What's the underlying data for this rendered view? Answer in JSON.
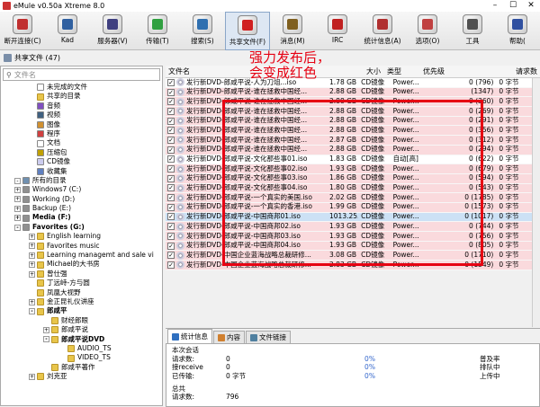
{
  "window": {
    "title": "eMule v0.50a Xtreme 8.0"
  },
  "toolbar": [
    {
      "label": "断开连接(C)",
      "icon": "disconnect-icon",
      "color": "#c03030"
    },
    {
      "label": "Kad",
      "icon": "kad-icon",
      "color": "#3060a0"
    },
    {
      "label": "服务器(V)",
      "icon": "servers-icon",
      "color": "#404080"
    },
    {
      "label": "传输(T)",
      "icon": "transfer-icon",
      "color": "#30a040"
    },
    {
      "label": "搜索(S)",
      "icon": "search-icon",
      "color": "#3070b0"
    },
    {
      "label": "共享文件(F)",
      "icon": "shared-files-icon",
      "color": "#d02020"
    },
    {
      "label": "消息(M)",
      "icon": "messages-icon",
      "color": "#806020"
    },
    {
      "label": "IRC",
      "icon": "irc-icon",
      "color": "#c02020"
    },
    {
      "label": "统计信息(A)",
      "icon": "statistics-icon",
      "color": "#b03030"
    },
    {
      "label": "选项(O)",
      "icon": "options-icon",
      "color": "#c04040"
    },
    {
      "label": "工具",
      "icon": "tools-icon",
      "color": "#505050"
    },
    {
      "label": "帮助(",
      "icon": "help-icon",
      "color": "#3050a0"
    }
  ],
  "shared": {
    "title": "共享文件 (47)"
  },
  "search": {
    "placeholder": "文件名"
  },
  "tree": [
    {
      "label": "未完成的文件",
      "indent": 40,
      "icon": "incomplete-icon",
      "color": "#ffffff"
    },
    {
      "label": "共享的目录",
      "indent": 40,
      "icon": "folder-icon",
      "color": "#e8c54a"
    },
    {
      "label": "音频",
      "indent": 40,
      "icon": "audio-icon",
      "color": "#8050c0"
    },
    {
      "label": "视频",
      "indent": 40,
      "icon": "video-icon",
      "color": "#406080"
    },
    {
      "label": "图像",
      "indent": 40,
      "icon": "image-icon",
      "color": "#d09030"
    },
    {
      "label": "程序",
      "indent": 40,
      "icon": "program-icon",
      "color": "#d04040"
    },
    {
      "label": "文档",
      "indent": 40,
      "icon": "document-icon",
      "color": "#ffffff"
    },
    {
      "label": "压缩包",
      "indent": 40,
      "icon": "archive-icon",
      "color": "#c0a000"
    },
    {
      "label": "CD镜像",
      "indent": 40,
      "icon": "cd-icon",
      "color": "#ccccee"
    },
    {
      "label": "收藏集",
      "indent": 40,
      "icon": "collection-icon",
      "color": "#6080c0"
    },
    {
      "label": "所有的目录",
      "indent": 24,
      "icon": "computer-icon",
      "color": "#7090b0",
      "exp": "-"
    },
    {
      "label": "Windows7 (C:)",
      "indent": 24,
      "icon": "drive-icon",
      "color": "#909090",
      "exp": "+"
    },
    {
      "label": "Working (D:)",
      "indent": 24,
      "icon": "drive-icon",
      "color": "#909090",
      "exp": "+"
    },
    {
      "label": "Backup (E:)",
      "indent": 24,
      "icon": "drive-icon",
      "color": "#909090",
      "exp": "+"
    },
    {
      "label": "Media (F:)",
      "indent": 24,
      "icon": "drive-icon",
      "color": "#909090",
      "exp": "+",
      "bold": true
    },
    {
      "label": "Favorites (G:)",
      "indent": 24,
      "icon": "drive-icon",
      "color": "#909090",
      "exp": "-",
      "bold": true
    },
    {
      "label": "English learning",
      "indent": 40,
      "icon": "folder-icon",
      "color": "#e8c54a",
      "exp": "+"
    },
    {
      "label": "Favorites music",
      "indent": 40,
      "icon": "folder-icon",
      "color": "#e8c54a",
      "exp": "+"
    },
    {
      "label": "Learning managemt and sale vi",
      "indent": 40,
      "icon": "folder-icon",
      "color": "#e8c54a",
      "exp": "+"
    },
    {
      "label": "Michael的大书房",
      "indent": 40,
      "icon": "folder-icon",
      "color": "#e8c54a",
      "exp": "+"
    },
    {
      "label": "曾仕强",
      "indent": 40,
      "icon": "folder-icon",
      "color": "#e8c54a",
      "exp": "+"
    },
    {
      "label": "丁远峙-方与圆",
      "indent": 40,
      "icon": "folder-icon",
      "color": "#e8c54a"
    },
    {
      "label": "凤凰大视野",
      "indent": 40,
      "icon": "folder-icon",
      "color": "#e8c54a"
    },
    {
      "label": "金正昆礼仪讲座",
      "indent": 40,
      "icon": "folder-icon",
      "color": "#e8c54a",
      "exp": "+"
    },
    {
      "label": "郎咸平",
      "indent": 40,
      "icon": "folder-icon",
      "color": "#e8c54a",
      "exp": "-",
      "bold": true
    },
    {
      "label": "财经郎眼",
      "indent": 56,
      "icon": "folder-icon",
      "color": "#e8c54a"
    },
    {
      "label": "郎咸平说",
      "indent": 56,
      "icon": "folder-icon",
      "color": "#e8c54a",
      "exp": "+"
    },
    {
      "label": "郎咸平说DVD",
      "indent": 56,
      "icon": "folder-icon",
      "color": "#e8c54a",
      "exp": "-",
      "bold": true
    },
    {
      "label": "AUDIO_TS",
      "indent": 74,
      "icon": "folder-icon",
      "color": "#e8c54a"
    },
    {
      "label": "VIDEO_TS",
      "indent": 74,
      "icon": "folder-icon",
      "color": "#e8c54a"
    },
    {
      "label": "郎咸平著作",
      "indent": 56,
      "icon": "folder-icon",
      "color": "#e8c54a"
    },
    {
      "label": "刘克亚",
      "indent": 40,
      "icon": "folder-icon",
      "color": "#e8c54a",
      "exp": "+"
    }
  ],
  "list": {
    "headers": {
      "name": "文件名",
      "size": "大小",
      "type": "类型",
      "priority": "优先级",
      "requests": "请求数"
    },
    "rows": [
      {
        "name": "发行新DVD-郎咸平说-人为刀俎...iso",
        "size": "1.78 GB",
        "type": "CD镜像",
        "prio": "Power...",
        "req": "0 (796)",
        "extra": "0 字节",
        "style": "white"
      },
      {
        "name": "发行新DVD-郎咸平说-谁在拯救中国经...",
        "size": "2.88 GB",
        "type": "CD镜像",
        "prio": "Power...",
        "req": "(1347)",
        "extra": "0 字节",
        "style": "pink"
      },
      {
        "name": "发行新DVD-郎咸平说-谁在拯救中国经...",
        "size": "2.88 GB",
        "type": "CD镜像",
        "prio": "Power...",
        "req": "0 (360)",
        "extra": "0 字节",
        "style": "pink"
      },
      {
        "name": "发行新DVD-郎咸平说-谁在拯救中国经...",
        "size": "2.88 GB",
        "type": "CD镜像",
        "prio": "Power...",
        "req": "0 (269)",
        "extra": "0 字节",
        "style": "pink"
      },
      {
        "name": "发行新DVD-郎咸平说-谁在拯救中国经...",
        "size": "2.88 GB",
        "type": "CD镜像",
        "prio": "Power...",
        "req": "0 (291)",
        "extra": "0 字节",
        "style": "pink"
      },
      {
        "name": "发行新DVD-郎咸平说-谁在拯救中国经...",
        "size": "2.88 GB",
        "type": "CD镜像",
        "prio": "Power...",
        "req": "0 (356)",
        "extra": "0 字节",
        "style": "pink"
      },
      {
        "name": "发行新DVD-郎咸平说-谁在拯救中国经...",
        "size": "2.87 GB",
        "type": "CD镜像",
        "prio": "Power...",
        "req": "0 (312)",
        "extra": "0 字节",
        "style": "pink"
      },
      {
        "name": "发行新DVD-郎咸平说-谁在拯救中国经...",
        "size": "2.88 GB",
        "type": "CD镜像",
        "prio": "Power...",
        "req": "0 (294)",
        "extra": "0 字节",
        "style": "pink"
      },
      {
        "name": "发行新DVD-郎咸平说-文化那些事01.iso",
        "size": "1.83 GB",
        "type": "CD镜像",
        "prio": "自动[高]",
        "req": "0 (622)",
        "extra": "0 字节",
        "style": "white"
      },
      {
        "name": "发行新DVD-郎咸平说-文化那些事02.iso",
        "size": "1.93 GB",
        "type": "CD镜像",
        "prio": "Power...",
        "req": "0 (679)",
        "extra": "0 字节",
        "style": "pink"
      },
      {
        "name": "发行新DVD-郎咸平说-文化那些事03.iso",
        "size": "1.86 GB",
        "type": "CD镜像",
        "prio": "Power...",
        "req": "0 (594)",
        "extra": "0 字节",
        "style": "pink"
      },
      {
        "name": "发行新DVD-郎咸平说-文化那些事04.iso",
        "size": "1.80 GB",
        "type": "CD镜像",
        "prio": "Power...",
        "req": "0 (543)",
        "extra": "0 字节",
        "style": "pink"
      },
      {
        "name": "发行新DVD-郎咸平说-一个真实的美国.iso",
        "size": "2.02 GB",
        "type": "CD镜像",
        "prio": "Power...",
        "req": "0 (1785)",
        "extra": "0 字节",
        "style": "pink"
      },
      {
        "name": "发行新DVD-郎咸平说-一个真实的香港.iso",
        "size": "1.99 GB",
        "type": "CD镜像",
        "prio": "Power...",
        "req": "0 (1573)",
        "extra": "0 字节",
        "style": "pink"
      },
      {
        "name": "发行新DVD-郎咸平说-中国商邦01.iso",
        "size": "1013.25...",
        "type": "CD镜像",
        "prio": "Power...",
        "req": "0 (1017)",
        "extra": "0 字节",
        "style": "sel"
      },
      {
        "name": "发行新DVD-郎咸平说-中国商邦02.iso",
        "size": "1.93 GB",
        "type": "CD镜像",
        "prio": "Power...",
        "req": "0 (744)",
        "extra": "0 字节",
        "style": "pink"
      },
      {
        "name": "发行新DVD-郎咸平说-中国商邦03.iso",
        "size": "1.93 GB",
        "type": "CD镜像",
        "prio": "Power...",
        "req": "0 (756)",
        "extra": "0 字节",
        "style": "pink"
      },
      {
        "name": "发行新DVD-郎咸平说-中国商邦04.iso",
        "size": "1.93 GB",
        "type": "CD镜像",
        "prio": "Power...",
        "req": "0 (805)",
        "extra": "0 字节",
        "style": "pink"
      },
      {
        "name": "发行新DVD-中国企业蓝海战略总裁研修...",
        "size": "3.08 GB",
        "type": "CD镜像",
        "prio": "Power...",
        "req": "0 (1710)",
        "extra": "0 字节",
        "style": "pink"
      },
      {
        "name": "发行新DVD-中国企业蓝海战略总裁研修...",
        "size": "2.83 GB",
        "type": "CD镜像",
        "prio": "Power...",
        "req": "0 (1549)",
        "extra": "0 字节",
        "style": "pink"
      }
    ]
  },
  "annotation": {
    "line1": "强力发布后，",
    "line2": "会变成红色"
  },
  "detail": {
    "tabs": [
      {
        "label": "统计信息",
        "icon": "statistics-icon"
      },
      {
        "label": "内容",
        "icon": "content-icon"
      },
      {
        "label": "文件链接",
        "icon": "link-icon"
      }
    ],
    "session_title": "本次会话",
    "rows": [
      {
        "label": "请求数:",
        "value": "0",
        "pct": "0%",
        "right": "普及率"
      },
      {
        "label": "接receive",
        "value": "0",
        "pct": "0%",
        "right": "排队中"
      },
      {
        "label": "已传输:",
        "value": "0 字节",
        "pct": "0%",
        "right": "上传中"
      }
    ],
    "total_title": "总共",
    "total_row": {
      "label": "请求数:",
      "value": "796"
    }
  }
}
